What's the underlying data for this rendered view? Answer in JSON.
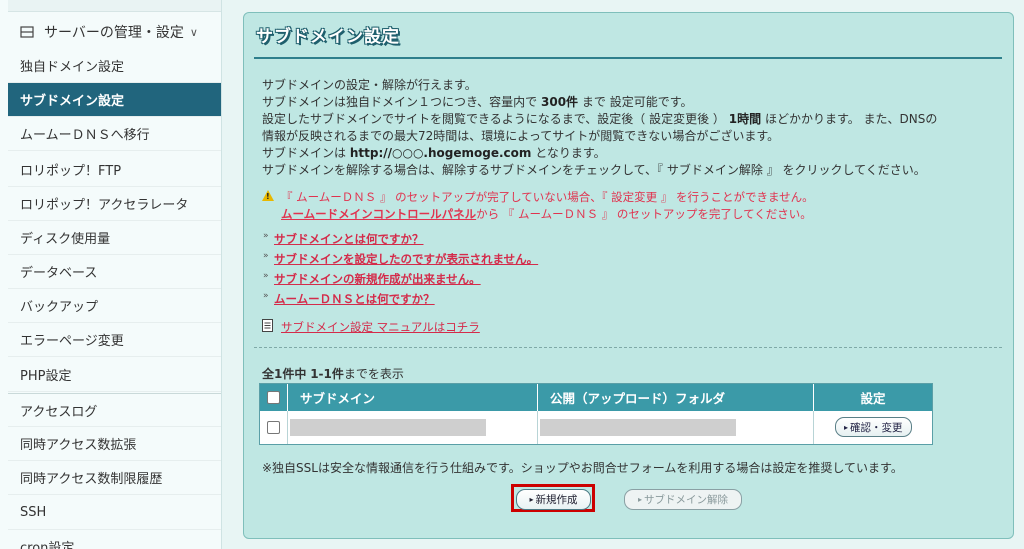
{
  "sidebar": {
    "header": "サーバーの管理・設定",
    "header_icon": "server-icon",
    "items": [
      {
        "label": "独自ドメイン設定"
      },
      {
        "label": "サブドメイン設定",
        "active": true
      },
      {
        "label": "ムームーＤＮＳへ移行"
      },
      {
        "label": "ロリポップ！FTP"
      },
      {
        "label": "ロリポップ！アクセラレータ"
      },
      {
        "label": "ディスク使用量"
      },
      {
        "label": "データベース"
      },
      {
        "label": "バックアップ"
      },
      {
        "label": "エラーページ変更"
      },
      {
        "label": "PHP設定"
      },
      {
        "label": "アクセスログ"
      },
      {
        "label": "同時アクセス数拡張"
      },
      {
        "label": "同時アクセス数制限履歴"
      },
      {
        "label": "SSH"
      },
      {
        "label": "cron設定"
      }
    ]
  },
  "main": {
    "title": "サブドメイン設定",
    "desc": {
      "l1": "サブドメインの設定・解除が行えます。",
      "l2a": "サブドメインは独自ドメイン１つにつき、容量内で",
      "l2b": "300件",
      "l2c": "まで 設定可能です。",
      "l3a": "設定したサブドメインでサイトを閲覧できるようになるまで、設定後（ 設定変更後 ）",
      "l3b": "1時間",
      "l3c": "ほどかかります。 また、DNSの",
      "l4": "情報が反映されるまでの最大72時間は、環境によってサイトが閲覧できない場合がございます。",
      "l5a": "サブドメインは",
      "l5b": "http://○○○.hogemoge.com",
      "l5c": "となります。",
      "l6": "サブドメインを解除する場合は、解除するサブドメインをチェックして、『 サブドメイン解除 』 をクリックしてください。"
    },
    "warning": {
      "line1": "『 ムームーＤＮＳ 』 のセットアップが完了していない場合、『 設定変更 』 を行うことができません。",
      "link": "ムームードメインコントロールパネル",
      "line2_rest": "から 『 ムームーＤＮＳ 』 のセットアップを完了してください。"
    },
    "faq_links": [
      "サブドメインとは何ですか？",
      "サブドメインを設定したのですが表示されません。",
      "サブドメインの新規作成が出来ません。",
      "ムームーＤＮＳとは何ですか？"
    ],
    "manual_link": "サブドメイン設定 マニュアルはコチラ",
    "count_text_a": "全1件中",
    "count_text_b": "1-1件",
    "count_text_c": "までを表示",
    "table": {
      "headers": [
        "サブドメイン",
        "公開（アップロード）フォルダ",
        "設定"
      ],
      "rows": [
        {
          "subdomain": "",
          "folder": "",
          "action": "確認・変更"
        }
      ]
    },
    "note": "※独自SSLは安全な情報通信を行う仕組みです。ショップやお問合せフォームを利用する場合は設定を推奨しています。",
    "new_button": "新規作成",
    "delete_button": "サブドメイン解除"
  },
  "colors": {
    "active_sidebar": "#21657d",
    "panel_bg": "#bfe7e3",
    "table_header": "#3b9aa8",
    "link_red": "#d42b4a",
    "highlight": "#cc0000"
  }
}
